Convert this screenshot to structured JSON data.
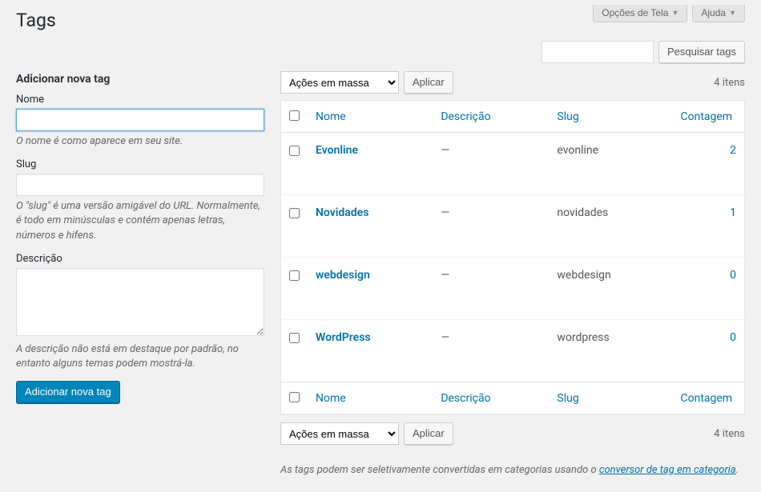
{
  "top": {
    "screen_options": "Opções de Tela",
    "help": "Ajuda"
  },
  "page_title": "Tags",
  "search": {
    "button": "Pesquisar tags"
  },
  "form": {
    "heading": "Adicionar nova tag",
    "name_label": "Nome",
    "name_hint": "O nome é como aparece em seu site.",
    "slug_label": "Slug",
    "slug_hint": "O \"slug\" é uma versão amigável do URL. Normalmente, é todo em minúsculas e contém apenas letras, números e hifens.",
    "desc_label": "Descrição",
    "desc_hint": "A descrição não está em destaque por padrão, no entanto alguns temas podem mostrá-la.",
    "submit": "Adicionar nova tag"
  },
  "bulk": {
    "label": "Ações em massa",
    "apply": "Aplicar",
    "count": "4 itens"
  },
  "columns": {
    "name": "Nome",
    "desc": "Descrição",
    "slug": "Slug",
    "count": "Contagem"
  },
  "rows": [
    {
      "name": "Evonline",
      "desc": "—",
      "slug": "evonline",
      "count": "2"
    },
    {
      "name": "Novidades",
      "desc": "—",
      "slug": "novidades",
      "count": "1"
    },
    {
      "name": "webdesign",
      "desc": "—",
      "slug": "webdesign",
      "count": "0"
    },
    {
      "name": "WordPress",
      "desc": "—",
      "slug": "wordpress",
      "count": "0"
    }
  ],
  "footer": {
    "text_before": "As tags podem ser seletivamente convertidas em categorias usando o ",
    "link": "conversor de tag em categoria",
    "text_after": "."
  }
}
